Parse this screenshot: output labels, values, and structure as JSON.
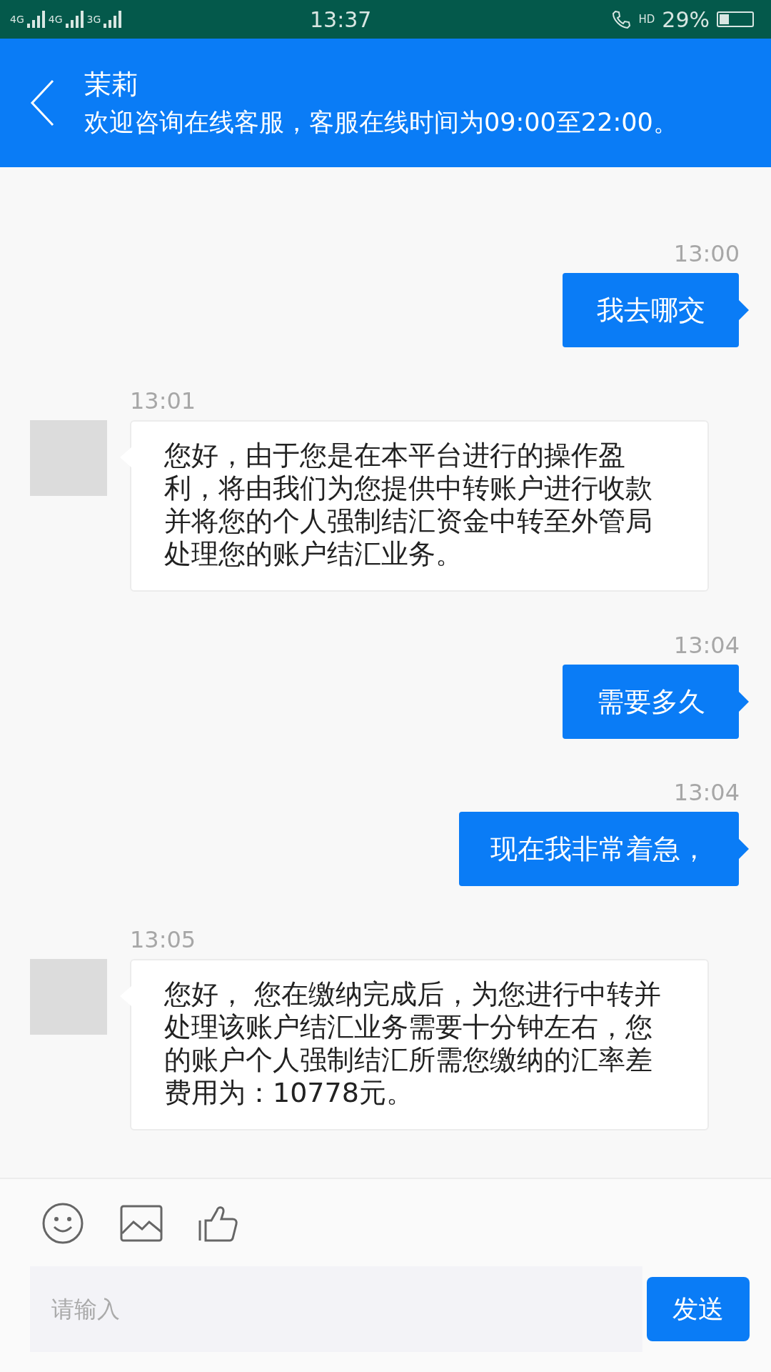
{
  "status_bar": {
    "network_labels": [
      "4G",
      "4G",
      "3G"
    ],
    "time": "13:37",
    "call_label": "HD",
    "battery": "29%"
  },
  "header": {
    "title": "茉莉",
    "subtitle": "欢迎咨询在线客服，客服在线时间为09:00至22:00。"
  },
  "messages": [
    {
      "kind": "outgoing",
      "time": "13:00",
      "text": "我去哪交"
    },
    {
      "kind": "incoming",
      "time": "13:01",
      "text": "您好，由于您是在本平台进行的操作盈利，将由我们为您提供中转账户进行收款并将您的个人强制结汇资金中转至外管局处理您的账户结汇业务。"
    },
    {
      "kind": "outgoing",
      "time": "13:04",
      "text": "需要多久"
    },
    {
      "kind": "outgoing",
      "time": "13:04",
      "text": "现在我非常着急，"
    },
    {
      "kind": "incoming",
      "time": "13:05",
      "text": "您好， 您在缴纳完成后，为您进行中转并处理该账户结汇业务需要十分钟左右，您的账户个人强制结汇所需您缴纳的汇率差费用为：10778元。"
    }
  ],
  "composer": {
    "placeholder": "请输入",
    "send": "发送"
  }
}
